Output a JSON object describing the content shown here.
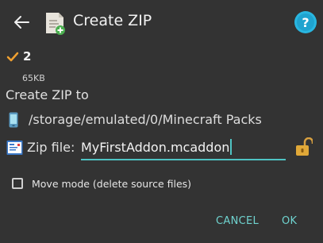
{
  "header": {
    "title": "Create ZIP",
    "back_icon": "back-arrow-icon",
    "app_icon": "zip-app-icon",
    "help_icon": "help-icon"
  },
  "selection": {
    "count": "2",
    "size": "65KB",
    "check_icon": "checkmark-icon"
  },
  "create_to_label": "Create ZIP to",
  "destination": {
    "path": "/storage/emulated/0/Minecraft Packs",
    "icon": "phone-storage-icon"
  },
  "zip_file": {
    "label": "Zip file:",
    "value": "MyFirstAddon.mcaddon",
    "icon": "zip-file-icon",
    "lock_icon": "unlocked-icon"
  },
  "move_mode": {
    "label": "Move mode (delete source files)",
    "checked": false
  },
  "buttons": {
    "cancel": "CANCEL",
    "ok": "OK"
  },
  "colors": {
    "background": "#333333",
    "accent": "#4fc3c3",
    "check": "#f0a030"
  }
}
